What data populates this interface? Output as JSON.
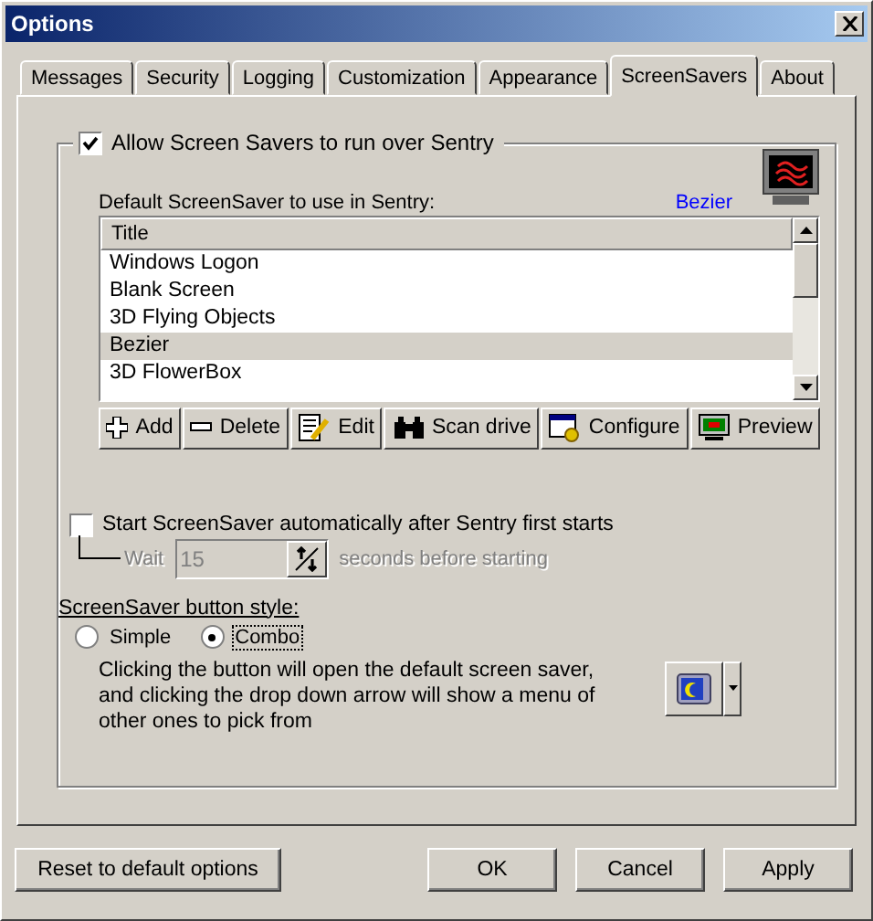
{
  "window": {
    "title": "Options"
  },
  "tabs": [
    {
      "label": "Messages",
      "selected": false
    },
    {
      "label": "Security",
      "selected": false
    },
    {
      "label": "Logging",
      "selected": false
    },
    {
      "label": "Customization",
      "selected": false
    },
    {
      "label": "Appearance",
      "selected": false
    },
    {
      "label": "ScreenSavers",
      "selected": true
    },
    {
      "label": "About",
      "selected": false
    }
  ],
  "allow": {
    "label": "Allow Screen Savers to run over Sentry",
    "checked": true
  },
  "default_label": "Default ScreenSaver to use in Sentry:",
  "current": "Bezier",
  "list": {
    "column": "Title",
    "rows": [
      {
        "title": "Windows Logon",
        "selected": false
      },
      {
        "title": "Blank Screen",
        "selected": false
      },
      {
        "title": "3D Flying Objects",
        "selected": false
      },
      {
        "title": "Bezier",
        "selected": true
      },
      {
        "title": "3D FlowerBox",
        "selected": false
      }
    ]
  },
  "toolbar": [
    {
      "kind": "add",
      "label": "Add"
    },
    {
      "kind": "delete",
      "label": "Delete"
    },
    {
      "kind": "edit",
      "label": "Edit"
    },
    {
      "kind": "scan",
      "label": "Scan drive"
    },
    {
      "kind": "configure",
      "label": "Configure"
    },
    {
      "kind": "preview",
      "label": "Preview"
    }
  ],
  "auto_start": {
    "label": "Start ScreenSaver automatically after Sentry first starts",
    "checked": false
  },
  "wait": {
    "label": "Wait",
    "value": "15",
    "suffix": "seconds before starting",
    "disabled": true
  },
  "button_style": {
    "heading": "ScreenSaver button style:",
    "options": [
      {
        "label": "Simple",
        "selected": false
      },
      {
        "label": "Combo",
        "selected": true
      }
    ],
    "description": "Clicking the button will open the default screen saver, and clicking the drop down arrow will show a menu of other ones to pick from"
  },
  "footer": {
    "reset": "Reset to default options",
    "ok": "OK",
    "cancel": "Cancel",
    "apply": "Apply"
  }
}
